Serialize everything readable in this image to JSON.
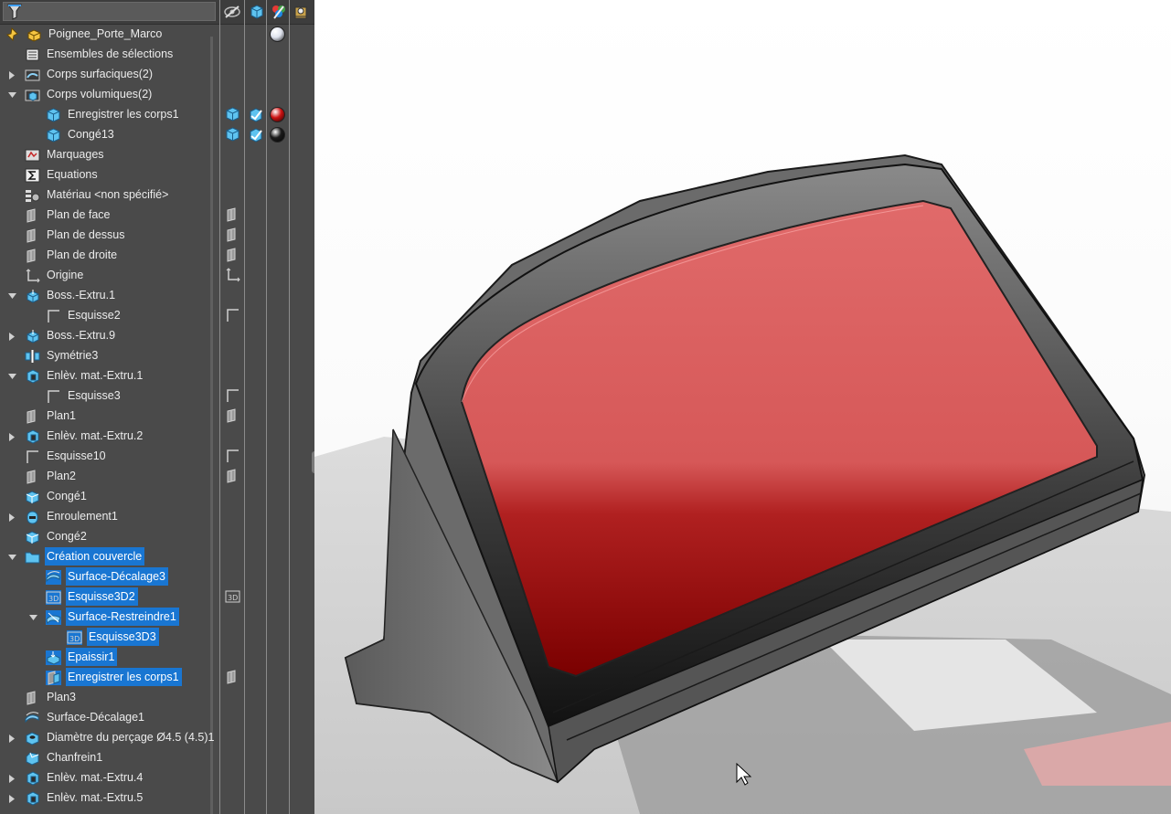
{
  "tree": {
    "items": [
      {
        "label": "Poignee_Porte_Marco",
        "icon": "part-icon",
        "arrow": "",
        "indent": 0,
        "selected": false
      },
      {
        "label": "Ensembles de sélections",
        "icon": "selection-set-icon",
        "arrow": "",
        "indent": 1,
        "selected": false
      },
      {
        "label": "Corps surfaciques(2)",
        "icon": "surface-bodies-icon",
        "arrow": "right",
        "indent": 1,
        "selected": false
      },
      {
        "label": "Corps volumiques(2)",
        "icon": "solid-bodies-icon",
        "arrow": "down",
        "indent": 1,
        "selected": false
      },
      {
        "label": "Enregistrer les corps1",
        "icon": "solid-body-icon",
        "arrow": "",
        "indent": 2,
        "selected": false
      },
      {
        "label": "Congé13",
        "icon": "solid-body-icon",
        "arrow": "",
        "indent": 2,
        "selected": false
      },
      {
        "label": "Marquages",
        "icon": "markups-icon",
        "arrow": "",
        "indent": 1,
        "selected": false
      },
      {
        "label": "Equations",
        "icon": "equations-icon",
        "arrow": "",
        "indent": 1,
        "selected": false
      },
      {
        "label": "Matériau <non spécifié>",
        "icon": "material-icon",
        "arrow": "",
        "indent": 1,
        "selected": false
      },
      {
        "label": "Plan de face",
        "icon": "plane-icon",
        "arrow": "",
        "indent": 1,
        "selected": false
      },
      {
        "label": "Plan de dessus",
        "icon": "plane-icon",
        "arrow": "",
        "indent": 1,
        "selected": false
      },
      {
        "label": "Plan de droite",
        "icon": "plane-icon",
        "arrow": "",
        "indent": 1,
        "selected": false
      },
      {
        "label": "Origine",
        "icon": "origin-icon",
        "arrow": "",
        "indent": 1,
        "selected": false
      },
      {
        "label": "Boss.-Extru.1",
        "icon": "extrude-icon",
        "arrow": "down",
        "indent": 1,
        "selected": false
      },
      {
        "label": "Esquisse2",
        "icon": "sketch-icon",
        "arrow": "",
        "indent": 2,
        "selected": false
      },
      {
        "label": "Boss.-Extru.9",
        "icon": "extrude-icon",
        "arrow": "right",
        "indent": 1,
        "selected": false
      },
      {
        "label": "Symétrie3",
        "icon": "mirror-icon",
        "arrow": "",
        "indent": 1,
        "selected": false
      },
      {
        "label": "Enlèv. mat.-Extru.1",
        "icon": "cut-extrude-icon",
        "arrow": "down",
        "indent": 1,
        "selected": false
      },
      {
        "label": "Esquisse3",
        "icon": "sketch-icon",
        "arrow": "",
        "indent": 2,
        "selected": false
      },
      {
        "label": "Plan1",
        "icon": "plane-icon",
        "arrow": "",
        "indent": 1,
        "selected": false
      },
      {
        "label": "Enlèv. mat.-Extru.2",
        "icon": "cut-extrude-icon",
        "arrow": "right",
        "indent": 1,
        "selected": false
      },
      {
        "label": "Esquisse10",
        "icon": "sketch-icon",
        "arrow": "",
        "indent": 1,
        "selected": false
      },
      {
        "label": "Plan2",
        "icon": "plane-icon",
        "arrow": "",
        "indent": 1,
        "selected": false
      },
      {
        "label": "Congé1",
        "icon": "fillet-icon",
        "arrow": "",
        "indent": 1,
        "selected": false
      },
      {
        "label": "Enroulement1",
        "icon": "wrap-icon",
        "arrow": "right",
        "indent": 1,
        "selected": false
      },
      {
        "label": "Congé2",
        "icon": "fillet-icon",
        "arrow": "",
        "indent": 1,
        "selected": false
      },
      {
        "label": "Création couvercle",
        "icon": "folder-icon",
        "arrow": "down",
        "indent": 1,
        "selected": true
      },
      {
        "label": "Surface-Décalage3",
        "icon": "offset-surface-icon",
        "arrow": "",
        "indent": 2,
        "selected": true
      },
      {
        "label": "Esquisse3D2",
        "icon": "sketch3d-icon",
        "arrow": "",
        "indent": 2,
        "selected": true
      },
      {
        "label": "Surface-Restreindre1",
        "icon": "trim-surface-icon",
        "arrow": "down",
        "indent": 2,
        "selected": true
      },
      {
        "label": "Esquisse3D3",
        "icon": "sketch3d-icon",
        "arrow": "",
        "indent": 3,
        "selected": true
      },
      {
        "label": "Epaissir1",
        "icon": "thicken-icon",
        "arrow": "",
        "indent": 2,
        "selected": true
      },
      {
        "label": "Enregistrer les corps1",
        "icon": "save-bodies-icon",
        "arrow": "",
        "indent": 2,
        "selected": true
      },
      {
        "label": "Plan3",
        "icon": "plane-icon",
        "arrow": "",
        "indent": 1,
        "selected": false
      },
      {
        "label": "Surface-Décalage1",
        "icon": "offset-surface-icon",
        "arrow": "",
        "indent": 1,
        "selected": false
      },
      {
        "label": "Diamètre du perçage Ø4.5 (4.5)1",
        "icon": "hole-icon",
        "arrow": "right",
        "indent": 1,
        "selected": false
      },
      {
        "label": "Chanfrein1",
        "icon": "chamfer-icon",
        "arrow": "",
        "indent": 1,
        "selected": false
      },
      {
        "label": "Enlèv. mat.-Extru.4",
        "icon": "cut-extrude-icon",
        "arrow": "right",
        "indent": 1,
        "selected": false
      },
      {
        "label": "Enlèv. mat.-Extru.5",
        "icon": "cut-extrude-icon",
        "arrow": "right",
        "indent": 1,
        "selected": false
      }
    ]
  },
  "columns": {
    "header_icons": [
      "hide-show-icon",
      "solid-body-icon",
      "appearance-icon",
      "display-pane-icon"
    ],
    "hide_show": [
      {
        "row": 4,
        "icon": "solid-body-icon"
      },
      {
        "row": 5,
        "icon": "solid-body-icon"
      },
      {
        "row": 9,
        "icon": "plane-icon"
      },
      {
        "row": 10,
        "icon": "plane-icon"
      },
      {
        "row": 11,
        "icon": "plane-icon"
      },
      {
        "row": 12,
        "icon": "origin-icon"
      },
      {
        "row": 14,
        "icon": "sketch-icon"
      },
      {
        "row": 18,
        "icon": "sketch-icon"
      },
      {
        "row": 19,
        "icon": "plane-icon"
      },
      {
        "row": 21,
        "icon": "sketch-icon"
      },
      {
        "row": 22,
        "icon": "plane-icon"
      },
      {
        "row": 28,
        "icon": "sketch3d-icon"
      },
      {
        "row": 32,
        "icon": "plane-icon"
      }
    ],
    "display_mode": [
      {
        "row": 4,
        "icon": "shaded-edges-icon"
      },
      {
        "row": 5,
        "icon": "shaded-edges-icon"
      }
    ],
    "appearance": [
      {
        "row": 0,
        "icon": "appearance-swatch-icon",
        "color": "#dfe3ee"
      },
      {
        "row": 4,
        "icon": "appearance-swatch-icon",
        "color": "#cc1111"
      },
      {
        "row": 5,
        "icon": "appearance-swatch-icon",
        "color": "#1a1a1a"
      }
    ]
  },
  "colors": {
    "panel_bg": "#4a4a4a",
    "selection": "#1976d2",
    "lid_red": "#de5f5f",
    "housing_gray": "#6b6b6b"
  }
}
